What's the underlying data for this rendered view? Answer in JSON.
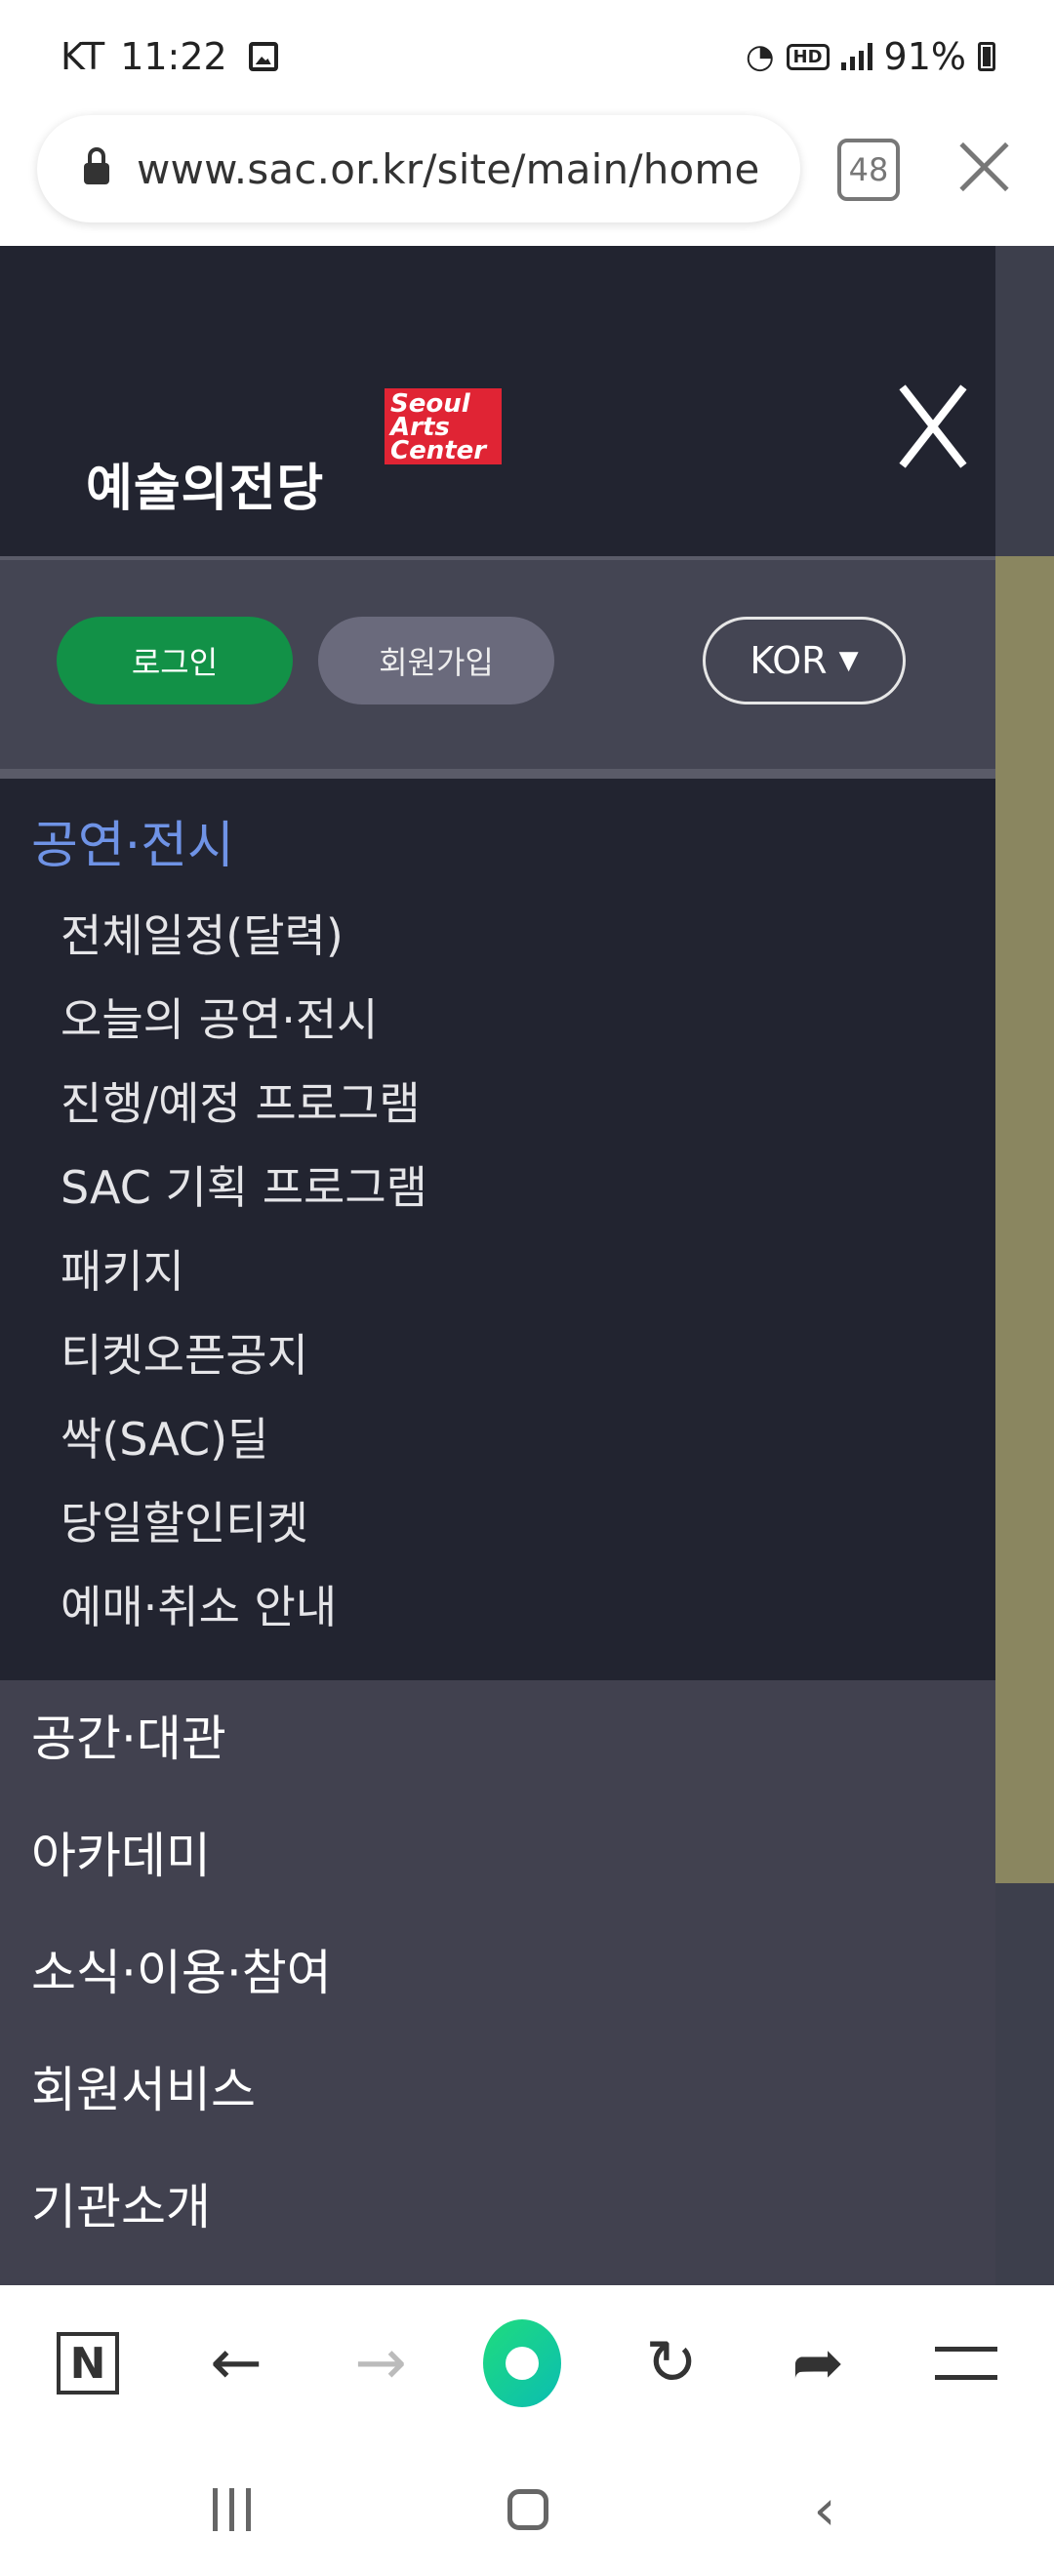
{
  "status_bar": {
    "carrier": "KT",
    "time": "11:22",
    "battery": "91%"
  },
  "browser": {
    "url": "www.sac.or.kr/site/main/home",
    "tab_count": "48"
  },
  "drawer": {
    "logo_text_ko": "예술의전당",
    "logo_box_lines": [
      "Seoul",
      "Arts",
      "Center"
    ],
    "login_label": "로그인",
    "join_label": "회원가입",
    "language_label": "KOR",
    "active_category": "공연·전시",
    "subitems": [
      "전체일정(달력)",
      "오늘의 공연·전시",
      "진행/예정 프로그램",
      "SAC 기획 프로그램",
      "패키지",
      "티켓오픈공지",
      "싹(SAC)딜",
      "당일할인티켓",
      "예매·취소 안내"
    ],
    "categories": [
      "공간·대관",
      "아카데미",
      "소식·이용·참여",
      "회원서비스",
      "기관소개"
    ]
  },
  "toolbar": {
    "n_label": "N"
  },
  "icons": {
    "back": "arrow-left-icon",
    "forward": "arrow-right-icon",
    "reload": "reload-icon",
    "share": "share-icon",
    "menu": "hamburger-icon"
  }
}
